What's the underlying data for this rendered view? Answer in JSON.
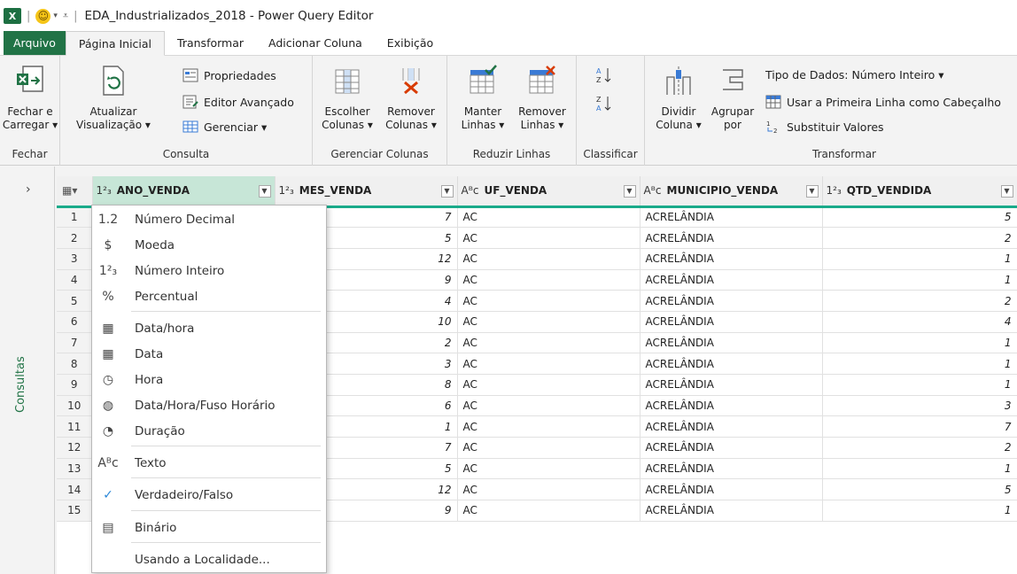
{
  "window": {
    "title": "EDA_Industrializados_2018 - Power Query Editor",
    "app_icon": "excel-logo-icon",
    "colors": {
      "accent": "#217346",
      "header_rule": "#1aab8a",
      "selected_header": "#c7e6d7"
    }
  },
  "tabs": [
    {
      "label": "Arquivo"
    },
    {
      "label": "Página Inicial"
    },
    {
      "label": "Transformar"
    },
    {
      "label": "Adicionar Coluna"
    },
    {
      "label": "Exibição"
    }
  ],
  "ribbon": {
    "fechar": {
      "button_line1": "Fechar e",
      "button_line2": "Carregar ▾",
      "group": "Fechar"
    },
    "consulta": {
      "atualizar_line1": "Atualizar",
      "atualizar_line2": "Visualização ▾",
      "propriedades": "Propriedades",
      "editor": "Editor Avançado",
      "gerenciar": "Gerenciar ▾",
      "group": "Consulta"
    },
    "gerenciar_colunas": {
      "escolher_line1": "Escolher",
      "escolher_line2": "Colunas ▾",
      "remover_line1": "Remover",
      "remover_line2": "Colunas ▾",
      "group": "Gerenciar Colunas"
    },
    "reduzir_linhas": {
      "manter_line1": "Manter",
      "manter_line2": "Linhas ▾",
      "remover_line1": "Remover",
      "remover_line2": "Linhas ▾",
      "group": "Reduzir Linhas"
    },
    "classificar": {
      "group": "Classificar"
    },
    "transformar": {
      "dividir_line1": "Dividir",
      "dividir_line2": "Coluna ▾",
      "agrupar_line1": "Agrupar",
      "agrupar_line2": "por",
      "tipo_dados": "Tipo de Dados: Número Inteiro ▾",
      "primeira_linha": "Usar a Primeira Linha como Cabeçalho",
      "substituir": "Substituir Valores",
      "group": "Transformar"
    }
  },
  "left_panel": {
    "label": "Consultas"
  },
  "grid": {
    "columns": [
      {
        "type": "1²₃",
        "name": "ANO_VENDA"
      },
      {
        "type": "1²₃",
        "name": "MES_VENDA"
      },
      {
        "type": "Aᴮc",
        "name": "UF_VENDA"
      },
      {
        "type": "Aᴮc",
        "name": "MUNICIPIO_VENDA"
      },
      {
        "type": "1²₃",
        "name": "QTD_VENDIDA"
      }
    ],
    "rows": [
      {
        "n": "1",
        "mes": "7",
        "uf": "AC",
        "mun": "ACRELÂNDIA",
        "qtd": "5"
      },
      {
        "n": "2",
        "mes": "5",
        "uf": "AC",
        "mun": "ACRELÂNDIA",
        "qtd": "2"
      },
      {
        "n": "3",
        "mes": "12",
        "uf": "AC",
        "mun": "ACRELÂNDIA",
        "qtd": "1"
      },
      {
        "n": "4",
        "mes": "9",
        "uf": "AC",
        "mun": "ACRELÂNDIA",
        "qtd": "1"
      },
      {
        "n": "5",
        "mes": "4",
        "uf": "AC",
        "mun": "ACRELÂNDIA",
        "qtd": "2"
      },
      {
        "n": "6",
        "mes": "10",
        "uf": "AC",
        "mun": "ACRELÂNDIA",
        "qtd": "4"
      },
      {
        "n": "7",
        "mes": "2",
        "uf": "AC",
        "mun": "ACRELÂNDIA",
        "qtd": "1"
      },
      {
        "n": "8",
        "mes": "3",
        "uf": "AC",
        "mun": "ACRELÂNDIA",
        "qtd": "1"
      },
      {
        "n": "9",
        "mes": "8",
        "uf": "AC",
        "mun": "ACRELÂNDIA",
        "qtd": "1"
      },
      {
        "n": "10",
        "mes": "6",
        "uf": "AC",
        "mun": "ACRELÂNDIA",
        "qtd": "3"
      },
      {
        "n": "11",
        "mes": "1",
        "uf": "AC",
        "mun": "ACRELÂNDIA",
        "qtd": "7"
      },
      {
        "n": "12",
        "mes": "7",
        "uf": "AC",
        "mun": "ACRELÂNDIA",
        "qtd": "2"
      },
      {
        "n": "13",
        "mes": "5",
        "uf": "AC",
        "mun": "ACRELÂNDIA",
        "qtd": "1"
      },
      {
        "n": "14",
        "mes": "12",
        "uf": "AC",
        "mun": "ACRELÂNDIA",
        "qtd": "5"
      },
      {
        "n": "15",
        "mes": "9",
        "uf": "AC",
        "mun": "ACRELÂNDIA",
        "qtd": "1"
      }
    ]
  },
  "type_menu": [
    {
      "icon": "1.2",
      "icon_name": "decimal-number-icon",
      "label": "Número Decimal"
    },
    {
      "icon": "$",
      "icon_name": "currency-icon",
      "label": "Moeda"
    },
    {
      "icon": "1²₃",
      "icon_name": "whole-number-icon",
      "label": "Número Inteiro"
    },
    {
      "icon": "%",
      "icon_name": "percentage-icon",
      "label": "Percentual"
    },
    {
      "icon": "▦",
      "icon_name": "datetime-icon",
      "label": "Data/hora"
    },
    {
      "icon": "▦",
      "icon_name": "date-icon",
      "label": "Data"
    },
    {
      "icon": "◷",
      "icon_name": "time-icon",
      "label": "Hora"
    },
    {
      "icon": "◍",
      "icon_name": "datetime-timezone-icon",
      "label": "Data/Hora/Fuso Horário"
    },
    {
      "icon": "◔",
      "icon_name": "duration-icon",
      "label": "Duração"
    },
    {
      "icon": "Aᴮc",
      "icon_name": "text-icon",
      "label": "Texto"
    },
    {
      "icon": "✓",
      "icon_name": "true-false-icon",
      "label": "Verdadeiro/Falso"
    },
    {
      "icon": "▤",
      "icon_name": "binary-icon",
      "label": "Binário"
    },
    {
      "icon": "",
      "icon_name": "",
      "label": "Usando a Localidade..."
    }
  ]
}
